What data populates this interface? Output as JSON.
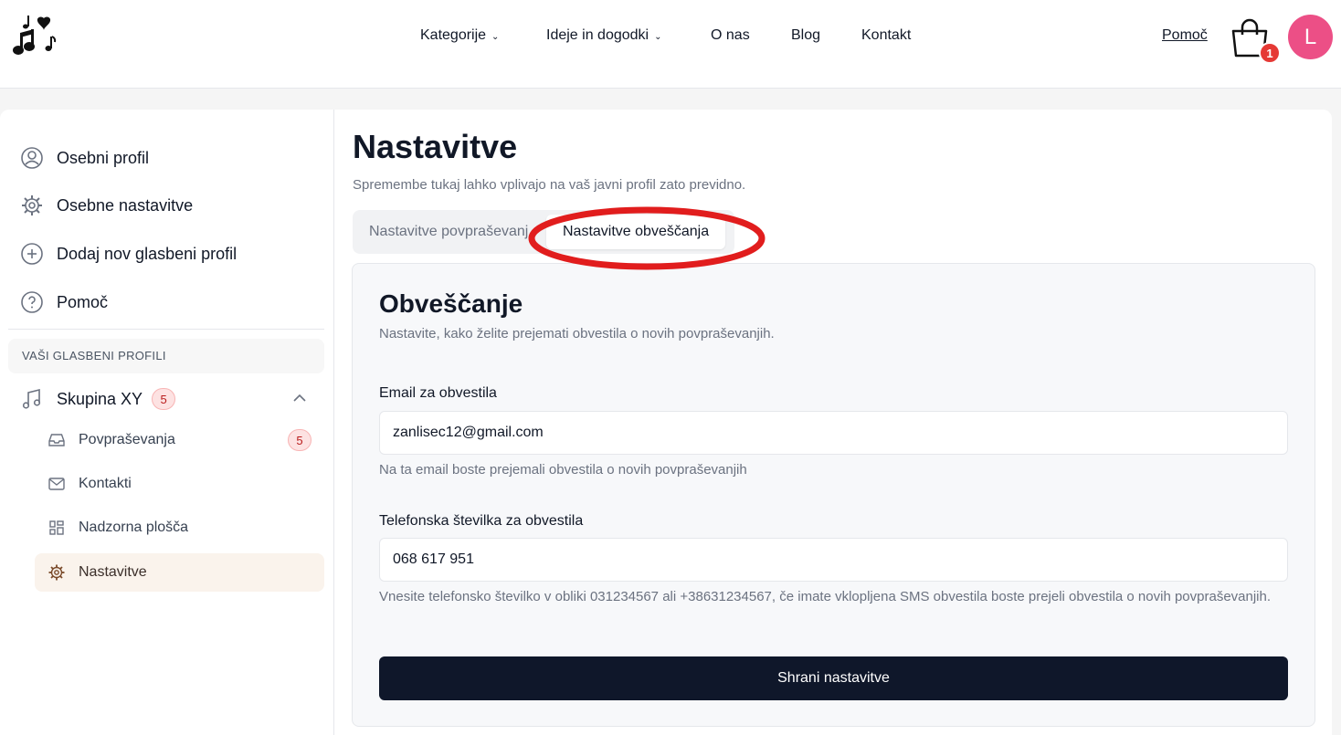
{
  "header": {
    "nav": [
      {
        "label": "Kategorije",
        "has_dropdown": true
      },
      {
        "label": "Ideje in dogodki",
        "has_dropdown": true
      },
      {
        "label": "O nas",
        "has_dropdown": false
      },
      {
        "label": "Blog",
        "has_dropdown": false
      },
      {
        "label": "Kontakt",
        "has_dropdown": false
      }
    ],
    "help_label": "Pomoč",
    "cart_count": "1",
    "avatar_initial": "L",
    "icons": [
      "music-notes-logo-icon",
      "shopping-bag-icon"
    ]
  },
  "sidebar": {
    "items": [
      {
        "label": "Osebni profil",
        "icon": "user-circle-icon"
      },
      {
        "label": "Osebne nastavitve",
        "icon": "gear-icon"
      },
      {
        "label": "Dodaj nov glasbeni profil",
        "icon": "plus-circle-icon"
      },
      {
        "label": "Pomoč",
        "icon": "question-circle-icon"
      }
    ],
    "section_label": "VAŠI GLASBENI PROFILI",
    "group": {
      "label": "Skupina XY",
      "badge": "5",
      "icon": "music-note-icon"
    },
    "sub_items": [
      {
        "label": "Povpraševanja",
        "icon": "inbox-icon",
        "badge": "5"
      },
      {
        "label": "Kontakti",
        "icon": "mail-icon"
      },
      {
        "label": "Nadzorna plošča",
        "icon": "dashboard-icon"
      },
      {
        "label": "Nastavitve",
        "icon": "gear-icon",
        "active": true
      }
    ]
  },
  "main": {
    "title": "Nastavitve",
    "subtitle": "Spremembe tukaj lahko vplivajo na vaš javni profil zato previdno.",
    "tabs": [
      {
        "label": "Nastavitve povpraševanj",
        "active": false
      },
      {
        "label": "Nastavitve obveščanja",
        "active": true
      }
    ],
    "card": {
      "title": "Obveščanje",
      "subtitle": "Nastavite, kako želite prejemati obvestila o novih povpraševanjih.",
      "email": {
        "label": "Email za obvestila",
        "value": "zanlisec12@gmail.com",
        "help": "Na ta email boste prejemali obvestila o novih povpraševanjih"
      },
      "phone": {
        "label": "Telefonska številka za obvestila",
        "value": "068 617 951",
        "help": "Vnesite telefonsko številko v obliki 031234567 ali +38631234567, če imate vklopljena SMS obvestila boste prejeli obvestila o novih povpraševanjih."
      },
      "save_label": "Shrani nastavitve"
    }
  },
  "colors": {
    "accent_pink": "#ec4f86",
    "badge_red": "#e53935",
    "button_dark": "#0f172a",
    "annotation_red": "#e11d1d",
    "active_bg": "#faf3ec"
  }
}
